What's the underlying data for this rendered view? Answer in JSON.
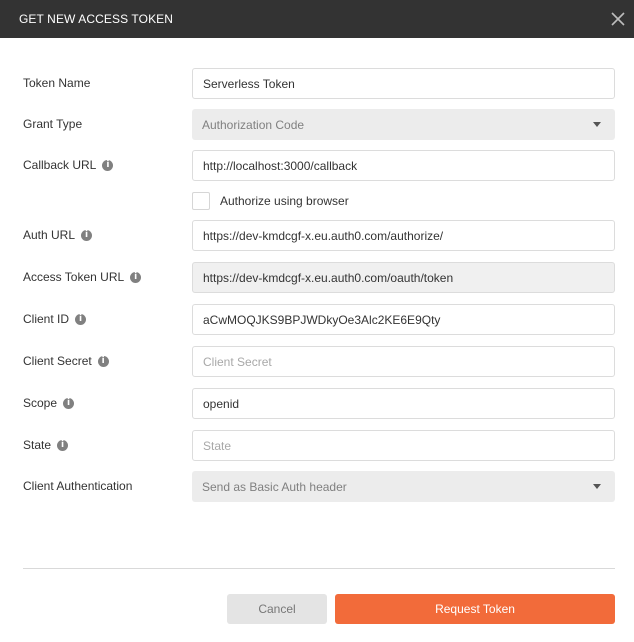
{
  "dialog": {
    "title": "GET NEW ACCESS TOKEN",
    "close_icon": "close-icon"
  },
  "fields": {
    "token_name": {
      "label": "Token Name",
      "value": "Serverless Token"
    },
    "grant_type": {
      "label": "Grant Type",
      "value": "Authorization Code"
    },
    "callback_url": {
      "label": "Callback URL",
      "value": "http://localhost:3000/callback"
    },
    "authorize_browser": {
      "label": "Authorize using browser",
      "checked": false
    },
    "auth_url": {
      "label": "Auth URL",
      "value": "https://dev-kmdcgf-x.eu.auth0.com/authorize/"
    },
    "access_token_url": {
      "label": "Access Token URL",
      "value": "https://dev-kmdcgf-x.eu.auth0.com/oauth/token"
    },
    "client_id": {
      "label": "Client ID",
      "value": "aCwMOQJKS9BPJWDkyOe3Alc2KE6E9Qty"
    },
    "client_secret": {
      "label": "Client Secret",
      "value": "",
      "placeholder": "Client Secret"
    },
    "scope": {
      "label": "Scope",
      "value": "openid"
    },
    "state": {
      "label": "State",
      "value": "",
      "placeholder": "State"
    },
    "client_auth": {
      "label": "Client Authentication",
      "value": "Send as Basic Auth header"
    }
  },
  "buttons": {
    "cancel": "Cancel",
    "request": "Request Token"
  },
  "info_glyph": "i",
  "colors": {
    "titlebar": "#333333",
    "accent": "#f26b3a",
    "cancel_bg": "#e4e4e4"
  }
}
